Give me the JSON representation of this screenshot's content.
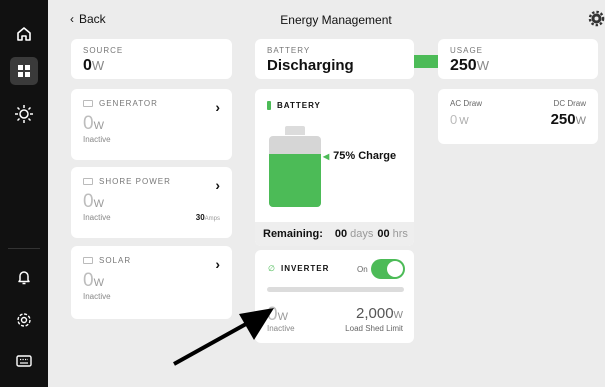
{
  "header": {
    "back_label": "Back",
    "title": "Energy Management"
  },
  "nav": {
    "icons": [
      "home-icon",
      "dashboard-icon",
      "sun-icon",
      "bell-icon",
      "settings-icon",
      "keyboard-icon"
    ],
    "active": "dashboard-icon"
  },
  "source": {
    "caption": "SOURCE",
    "value": "0",
    "unit": "W"
  },
  "generator": {
    "label": "GENERATOR",
    "value": "0",
    "unit": "W",
    "status": "Inactive"
  },
  "shore_power": {
    "label": "SHORE POWER",
    "value": "0",
    "unit": "W",
    "status": "Inactive",
    "amps": "30",
    "amps_unit": "Amps"
  },
  "solar": {
    "label": "SOLAR",
    "value": "0",
    "unit": "W",
    "status": "Inactive"
  },
  "battery_status": {
    "caption": "BATTERY",
    "state": "Discharging"
  },
  "battery": {
    "label": "BATTERY",
    "charge_text": "75% Charge",
    "charge_fraction": 0.75
  },
  "remaining": {
    "label": "Remaining:",
    "days_value": "00",
    "days_unit": "days",
    "hrs_value": "00",
    "hrs_unit": "hrs"
  },
  "inverter": {
    "label": "INVERTER",
    "toggle_label": "On",
    "toggle_on": true,
    "value": "0",
    "unit": "W",
    "status": "Inactive",
    "limit_value": "2,000",
    "limit_unit": "W",
    "limit_label": "Load Shed Limit",
    "load_fraction": 0
  },
  "usage": {
    "caption": "USAGE",
    "value": "250",
    "unit": "W"
  },
  "draw": {
    "ac_label": "AC Draw",
    "ac_value": "0",
    "ac_unit": "W",
    "dc_label": "DC Draw",
    "dc_value": "250",
    "dc_unit": "W"
  },
  "colors": {
    "accent": "#4cbb57",
    "sidebar": "#111111",
    "background": "#ececec"
  }
}
